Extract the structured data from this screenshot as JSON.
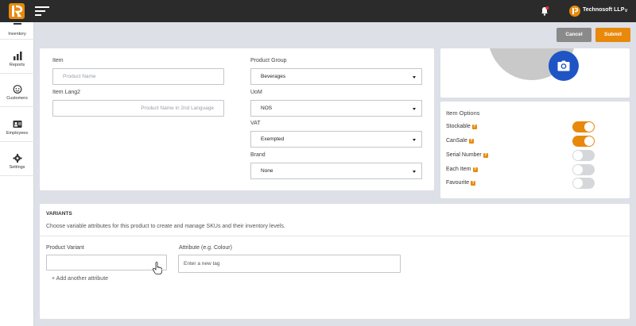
{
  "topbar": {
    "company_name": "Technosoft LLP",
    "company_caret": "∨",
    "icons": [
      "app-logo-icon",
      "hamburger-menu-icon",
      "bell-icon",
      "company-logo-icon",
      "chevron-down-icon"
    ]
  },
  "sidebar": {
    "items": [
      {
        "label": "Inventory",
        "icon": "inventory-icon"
      },
      {
        "label": "Reports",
        "icon": "bar-chart-icon"
      },
      {
        "label": "Customers",
        "icon": "customer-icon"
      },
      {
        "label": "Employees",
        "icon": "id-card-icon"
      },
      {
        "label": "Settings",
        "icon": "gear-icon"
      }
    ]
  },
  "actions": {
    "cancel_label": "Cancel",
    "submit_label": "Submit"
  },
  "item_form": {
    "item_label": "Item",
    "item_placeholder": "Product Name",
    "item_lang2_label": "Item Lang2",
    "item_lang2_placeholder": "Product Name in 2nd Language",
    "product_group_label": "Product Group",
    "product_group_value": "Beverages",
    "uom_label": "UoM",
    "uom_value": "NOS",
    "vat_label": "VAT",
    "vat_value": "Exempted",
    "brand_label": "Brand",
    "brand_value": "None"
  },
  "photo": {
    "icon": "camera-icon"
  },
  "item_options": {
    "title": "Item Options",
    "help_glyph": "?",
    "options": [
      {
        "label": "Stockable",
        "on": true
      },
      {
        "label": "CanSale",
        "on": true
      },
      {
        "label": "Serial Number",
        "on": false
      },
      {
        "label": "Each Item",
        "on": false
      },
      {
        "label": "Favourite",
        "on": false
      }
    ],
    "colors": {
      "on": "#e8890c",
      "off": "#d6d7da"
    }
  },
  "variants": {
    "title": "VARIANTS",
    "description": "Choose variable attributes for this product to create and manage SKUs and their inventory levels.",
    "product_variant_label": "Product Variant",
    "product_variant_value": "",
    "attribute_label": "Attribute (e.g. Colour)",
    "attribute_placeholder": "Enter a new tag",
    "add_another_label": "+ Add another attribute"
  },
  "colors": {
    "accent": "#e8890c",
    "camera": "#1f54c4",
    "topbar": "#2b2b2b"
  }
}
